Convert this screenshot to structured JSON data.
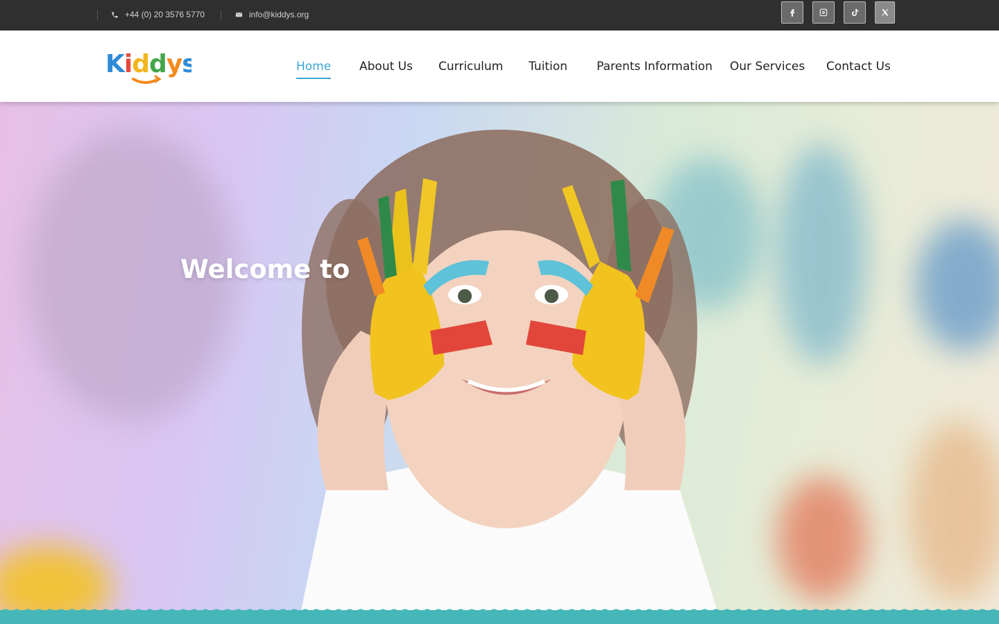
{
  "topbar": {
    "phone": "+44 (0) 20 3576 5770",
    "email": "info@kiddys.org",
    "social": [
      {
        "name": "facebook",
        "icon": "facebook-icon"
      },
      {
        "name": "instagram",
        "icon": "instagram-icon"
      },
      {
        "name": "tiktok",
        "icon": "tiktok-icon"
      },
      {
        "name": "x",
        "icon": "x-twitter-icon"
      }
    ]
  },
  "brand": {
    "logo_text": "Kiddys",
    "logo_letter_colors": [
      "#2f8bd6",
      "#e64a3b",
      "#f2b51d",
      "#45a54a",
      "#f28a1f",
      "#2f8bd6"
    ]
  },
  "nav": {
    "items": [
      {
        "label": "Home",
        "active": true
      },
      {
        "label": "About Us",
        "active": false
      },
      {
        "label": "Curriculum",
        "active": false
      },
      {
        "label": "Tuition",
        "active": false
      },
      {
        "label": "Parents Information",
        "active": false
      },
      {
        "label": "Our Services",
        "active": false
      },
      {
        "label": "Contact Us",
        "active": false
      }
    ]
  },
  "hero": {
    "heading": "Welcome to"
  },
  "colors": {
    "accent": "#3aa6d6",
    "topbar": "#2f2f2f",
    "wave": "#45b7b8"
  }
}
